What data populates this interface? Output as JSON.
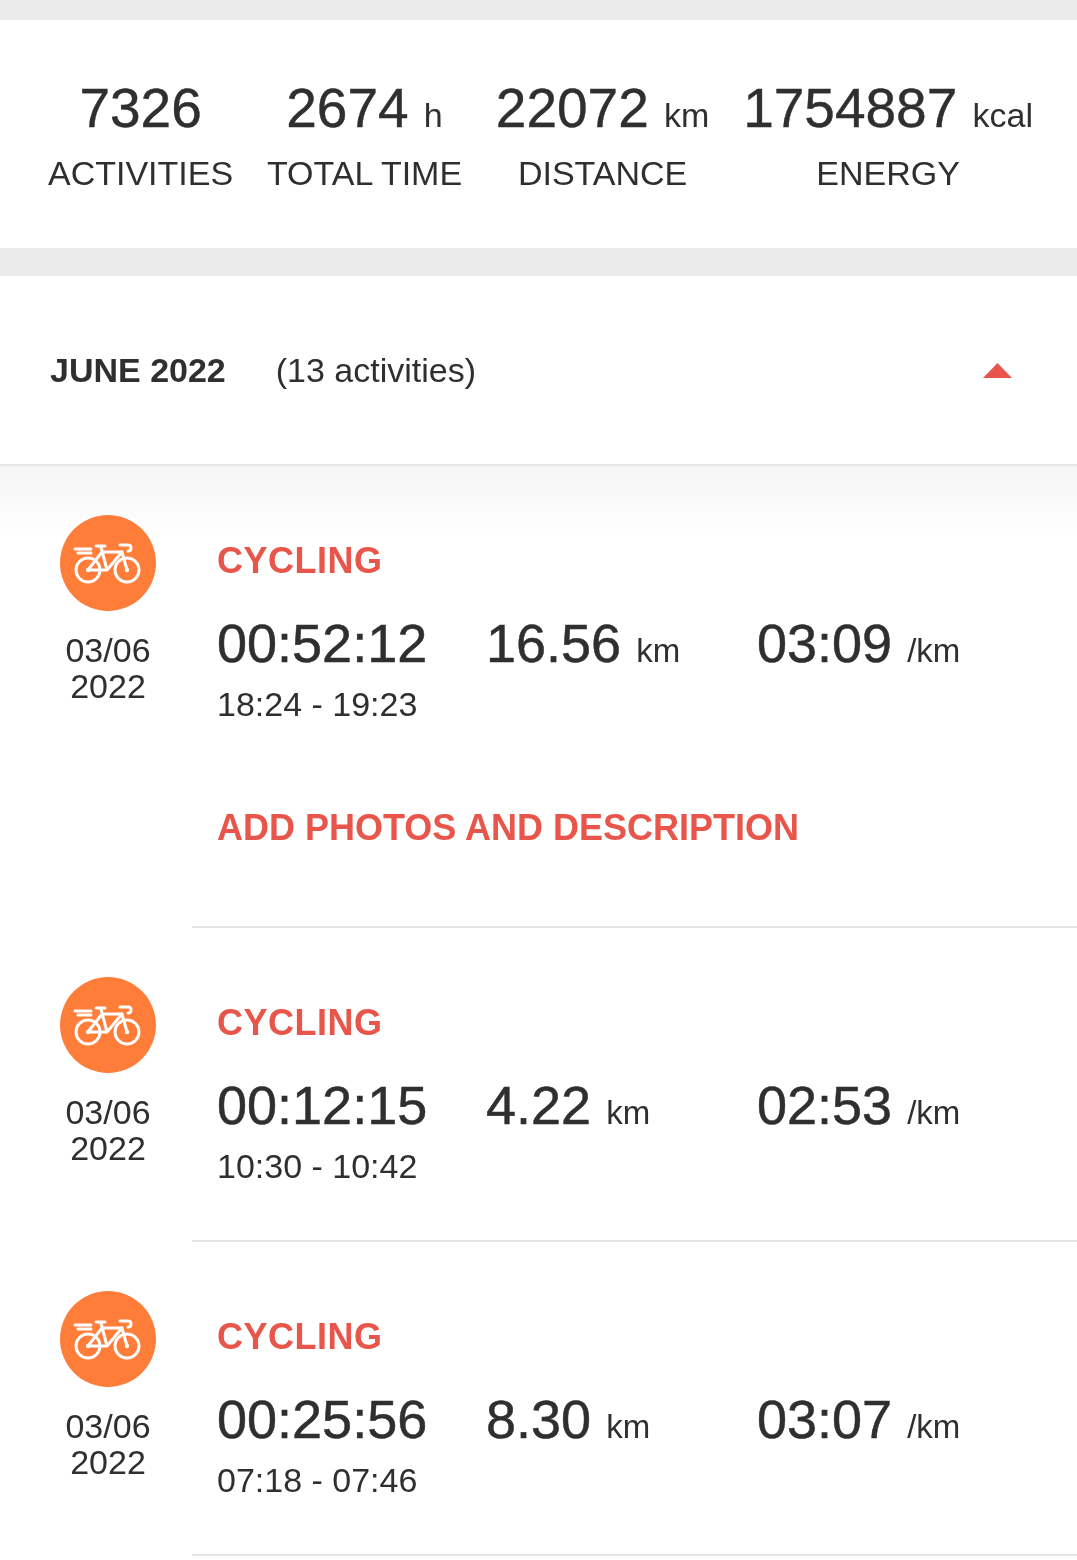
{
  "stats": [
    {
      "value": "7326",
      "label": "ACTIVITIES"
    },
    {
      "value": "2674",
      "unit": "h",
      "label": "TOTAL TIME"
    },
    {
      "value": "22072",
      "unit": "km",
      "label": "DISTANCE"
    },
    {
      "value": "1754887",
      "unit": "kcal",
      "label": "ENERGY"
    }
  ],
  "month": {
    "title": "JUNE 2022",
    "count": "(13 activities)",
    "expanded": true
  },
  "activities": [
    {
      "type": "CYCLING",
      "date": "03/06",
      "year": "2022",
      "duration": "00:52:12",
      "distance": "16.56",
      "distance_unit": "km",
      "pace": "03:09",
      "pace_unit": "/km",
      "time_range": "18:24 - 19:23",
      "action": "ADD PHOTOS AND DESCRIPTION"
    },
    {
      "type": "CYCLING",
      "date": "03/06",
      "year": "2022",
      "duration": "00:12:15",
      "distance": "4.22",
      "distance_unit": "km",
      "pace": "02:53",
      "pace_unit": "/km",
      "time_range": "10:30 - 10:42"
    },
    {
      "type": "CYCLING",
      "date": "03/06",
      "year": "2022",
      "duration": "00:25:56",
      "distance": "8.30",
      "distance_unit": "km",
      "pace": "03:07",
      "pace_unit": "/km",
      "time_range": "07:18 - 07:46"
    }
  ]
}
